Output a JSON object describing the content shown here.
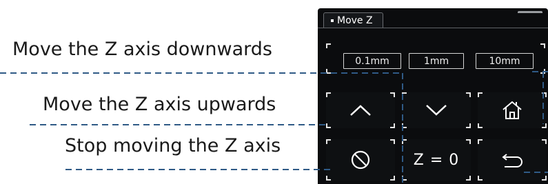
{
  "annotations": {
    "down": "Move the Z axis downwards",
    "up": "Move the Z axis upwards",
    "stop": "Stop moving the Z axis"
  },
  "panel": {
    "tab_label": "Move Z",
    "steps": [
      "0.1mm",
      "1mm",
      "10mm"
    ],
    "buttons": {
      "up_icon": "chevron-up-icon",
      "down_icon": "chevron-down-icon",
      "home_icon": "home-icon",
      "stop_icon": "stop-icon",
      "zero_label": "Z = 0",
      "back_icon": "back-arrow-icon"
    },
    "colors": {
      "panel_bg": "#0b0c0e",
      "foreground": "#ffffff",
      "guide_line": "#2f5a86"
    }
  }
}
